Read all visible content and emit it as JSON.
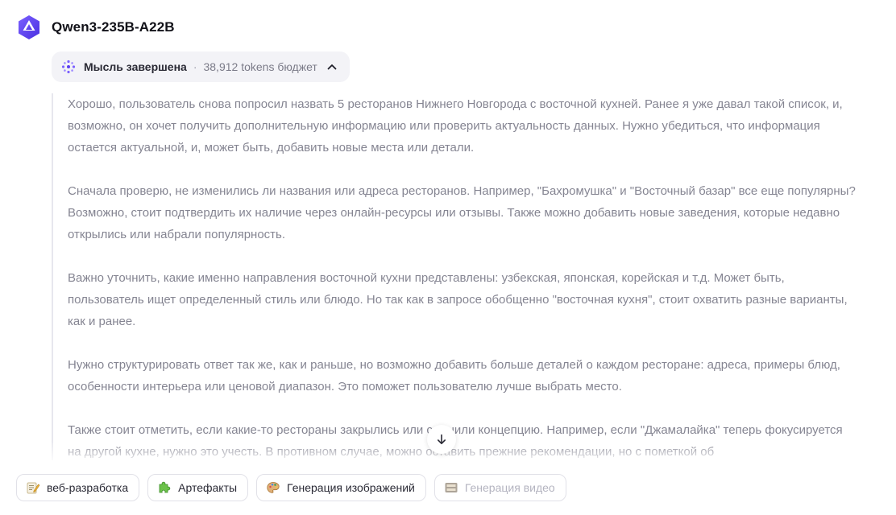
{
  "header": {
    "model_name": "Qwen3-235B-A22B",
    "logo_icon": "qwen-logo-icon",
    "accent_color": "#6a4cff"
  },
  "thought": {
    "title": "Мысль завершена",
    "separator": "·",
    "budget": "38,912 tokens бюджет",
    "toggle_icon": "chevron-up-icon"
  },
  "reasoning": {
    "paragraphs": [
      "Хорошо, пользователь снова попросил назвать 5 ресторанов Нижнего Новгорода с восточной кухней. Ранее я уже давал такой список, и, возможно, он хочет получить дополнительную информацию или проверить актуальность данных. Нужно убедиться, что информация остается актуальной, и, может быть, добавить новые места или детали.",
      "Сначала проверю, не изменились ли названия или адреса ресторанов. Например, \"Бахромушка\" и \"Восточный базар\" все еще популярны? Возможно, стоит подтвердить их наличие через онлайн-ресурсы или отзывы. Также можно добавить новые заведения, которые недавно открылись или набрали популярность.",
      "Важно уточнить, какие именно направления восточной кухни представлены: узбекская, японская, корейская и т.д. Может быть, пользователь ищет определенный стиль или блюдо. Но так как в запросе обобщенно \"восточная кухня\", стоит охватить разные варианты, как и ранее.",
      "Нужно структурировать ответ так же, как и раньше, но возможно добавить больше деталей о каждом ресторане: адреса, примеры блюд, особенности интерьера или ценовой диапазон. Это поможет пользователю лучше выбрать место.",
      "Также стоит отметить, если какие-то рестораны закрылись или сменили концепцию. Например, если \"Джамалайка\" теперь фокусируется на другой кухне, нужно это учесть. В противном случае, можно оставить прежние рекомендации, но с пометкой об"
    ]
  },
  "scroll_button": {
    "icon": "arrow-down-icon"
  },
  "chips": [
    {
      "label": "веб-разработка",
      "icon": "memo-pencil-icon",
      "disabled": false
    },
    {
      "label": "Артефакты",
      "icon": "puzzle-piece-icon",
      "disabled": false
    },
    {
      "label": "Генерация изображений",
      "icon": "artist-palette-icon",
      "disabled": false
    },
    {
      "label": "Генерация видео",
      "icon": "film-frames-icon",
      "disabled": true
    }
  ]
}
